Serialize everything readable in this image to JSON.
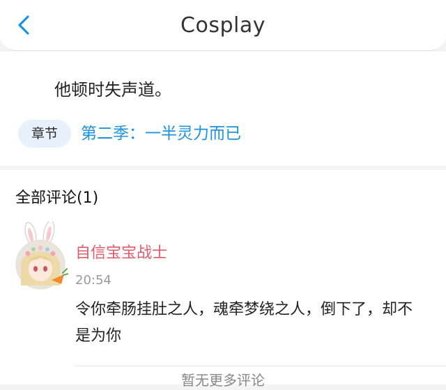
{
  "header": {
    "title": "Cosplay",
    "back_icon": "chevron-left-icon",
    "accent": "#1b93e0"
  },
  "chapter": {
    "body_text": "他顿时失声道。",
    "tag_label": "章节",
    "link_text": "第二季：一半灵力而已"
  },
  "comments": {
    "header": "全部评论(1)",
    "items": [
      {
        "username": "自信宝宝战士",
        "time": "20:54",
        "text": "令你牵肠挂肚之人，魂牵梦绕之人，倒下了，却不是为你"
      }
    ],
    "no_more": "暂无更多评论"
  },
  "colors": {
    "username": "#e25a6a",
    "link": "#1b93e0",
    "tag_bg": "#e6f1fb"
  }
}
